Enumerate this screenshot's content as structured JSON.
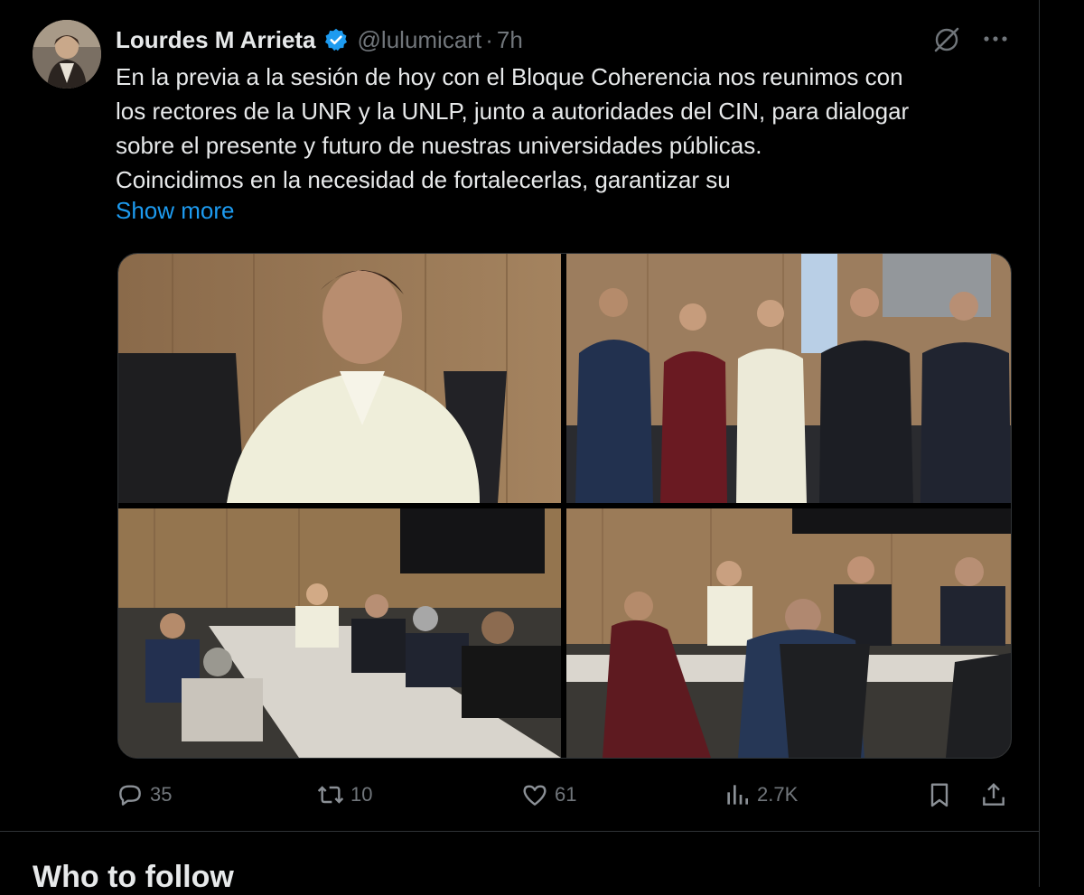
{
  "tweet": {
    "display_name": "Lourdes M Arrieta",
    "verified_icon": "verified-badge-icon",
    "handle": "@lulumicart",
    "separator": "·",
    "time": "7h",
    "text_lines": [
      "En la previa a la sesión de hoy con el Bloque Coherencia nos reunimos con",
      "los rectores de la UNR y la UNLP, junto a autoridades del CIN, para dialogar",
      "sobre el presente y futuro de nuestras universidades públicas.",
      "Coincidimos en la necesidad de fortalecerlas, garantizar su"
    ],
    "show_more": "Show more",
    "media": [
      {
        "name": "photo-woman-portrait"
      },
      {
        "name": "photo-group-standing"
      },
      {
        "name": "photo-meeting-table-left"
      },
      {
        "name": "photo-meeting-table-right"
      }
    ],
    "actions": {
      "replies": "35",
      "reposts": "10",
      "likes": "61",
      "views": "2.7K"
    },
    "icons": {
      "grok": "grok-icon",
      "more": "more-icon",
      "reply": "reply-icon",
      "repost": "repost-icon",
      "like": "heart-icon",
      "views": "views-icon",
      "bookmark": "bookmark-icon",
      "share": "share-icon"
    }
  },
  "sidebar_section": {
    "title": "Who to follow"
  },
  "colors": {
    "background": "#000000",
    "text": "#e7e9ea",
    "muted": "#71767b",
    "accent": "#1d9bf0",
    "border": "#2f3336"
  }
}
